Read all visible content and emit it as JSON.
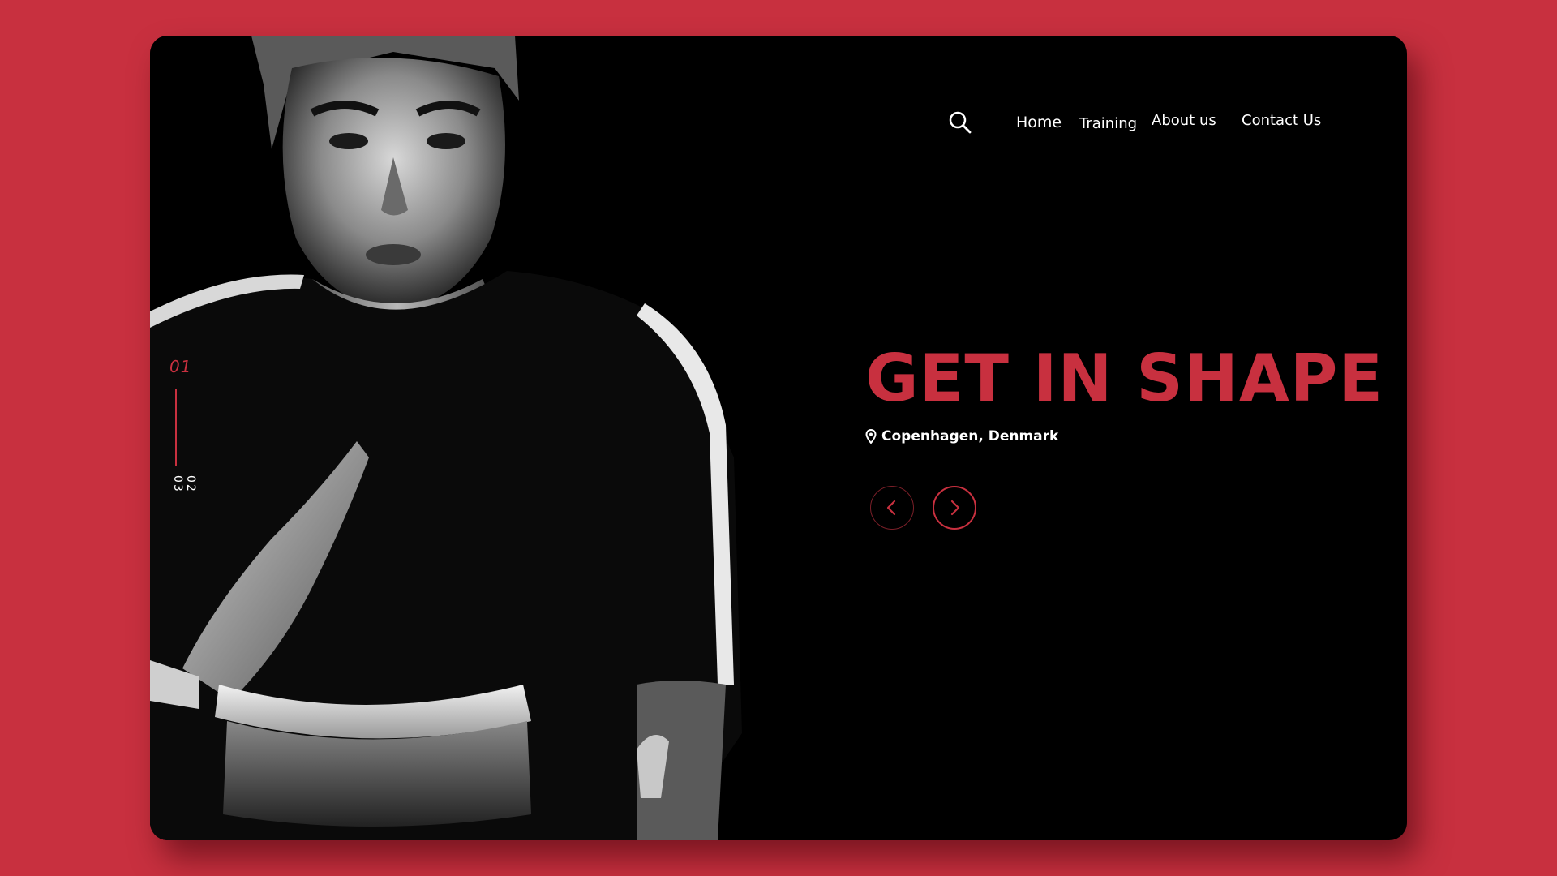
{
  "nav": {
    "search_icon": "search-icon",
    "links": [
      {
        "label": "Home"
      },
      {
        "label": "Training"
      },
      {
        "label": "About us"
      },
      {
        "label": "Contact Us"
      }
    ]
  },
  "hero": {
    "title": "GET IN SHAPE",
    "location": "Copenhagen, Denmark",
    "location_icon": "map-pin-icon"
  },
  "slider": {
    "current": "01",
    "others": [
      "02",
      "03"
    ],
    "prev_icon": "chevron-left-icon",
    "next_icon": "chevron-right-icon"
  },
  "colors": {
    "accent": "#c8303f",
    "background": "#000000",
    "page": "#c8303f",
    "text": "#ffffff"
  }
}
